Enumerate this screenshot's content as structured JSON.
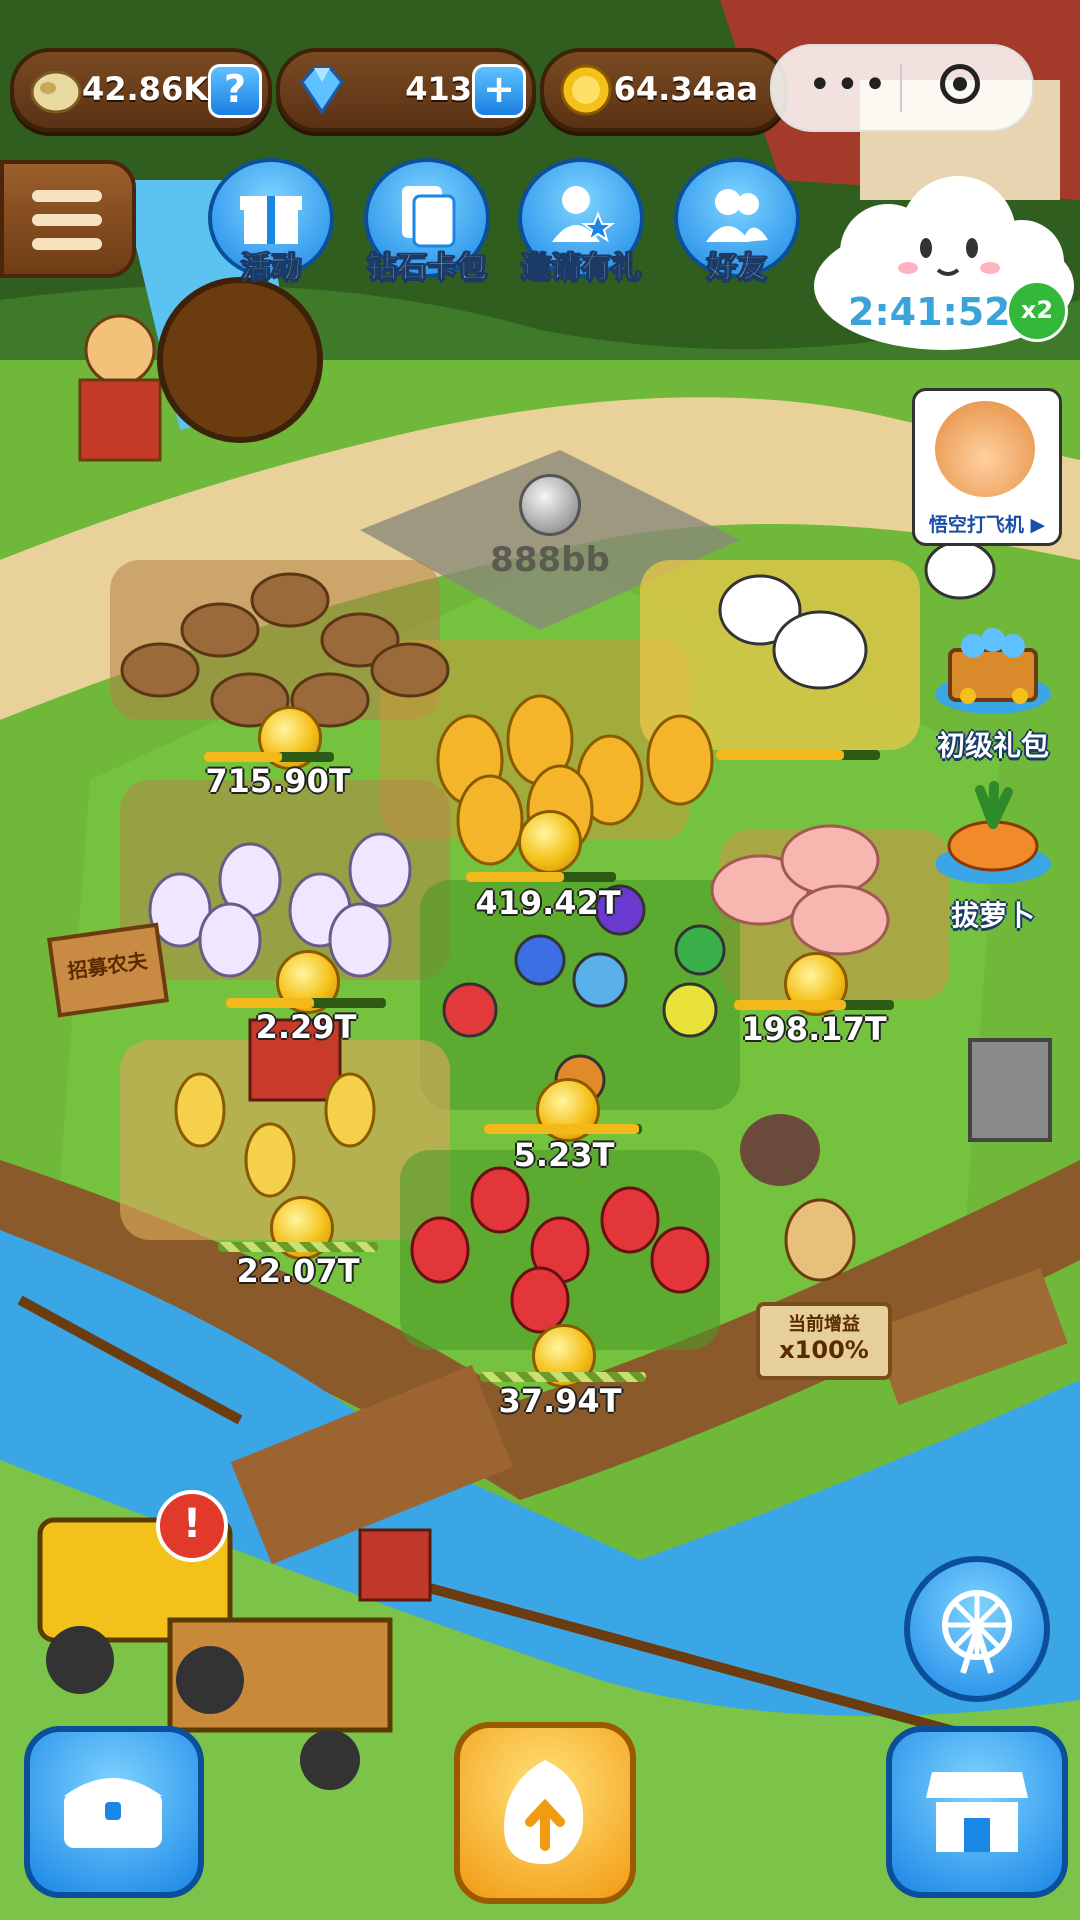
{
  "currencies": {
    "seeds": {
      "value": "42.86K",
      "icon": "seed-icon",
      "action": "help-icon"
    },
    "diamonds": {
      "value": "413",
      "icon": "diamond-icon",
      "action": "plus-icon"
    },
    "coins": {
      "value": "64.34aa",
      "icon": "coin-icon"
    }
  },
  "top_menu": [
    {
      "label": "活动",
      "icon": "gift-icon"
    },
    {
      "label": "钻石卡包",
      "icon": "card-pack-icon"
    },
    {
      "label": "邀请有礼",
      "icon": "invite-icon"
    },
    {
      "label": "好友",
      "icon": "friends-icon"
    }
  ],
  "cloud_timer": {
    "time": "2:41:52",
    "multiplier": "x2"
  },
  "ad": {
    "label": "悟空打飞机 ▶"
  },
  "side_panels": [
    {
      "label": "初级礼包",
      "icon": "treasure-chest-icon"
    },
    {
      "label": "拔萝卜",
      "icon": "carrot-icon"
    }
  ],
  "locked_plot": {
    "price": "888bb"
  },
  "plots": [
    {
      "name": "potato",
      "earning": "715.90T",
      "progress": 0.6
    },
    {
      "name": "pineapple",
      "earning": "419.42T",
      "progress": 0.65
    },
    {
      "name": "dog",
      "earning": "",
      "progress": 0.78
    },
    {
      "name": "radish",
      "earning": "2.29T",
      "progress": 0.55
    },
    {
      "name": "pig",
      "earning": "198.17T",
      "progress": 0.7
    },
    {
      "name": "gourd",
      "earning": "5.23T",
      "progress": 0.98
    },
    {
      "name": "chicken",
      "earning": "22.07T",
      "progress": 0.0
    },
    {
      "name": "strawberry",
      "earning": "37.94T",
      "progress": 0.0
    }
  ],
  "sign": {
    "text": "招募农夫"
  },
  "boost": {
    "line1": "当前增益",
    "line2": "x100%"
  },
  "colors": {
    "accent_blue": "#1a86e6",
    "coin_gold": "#f5c019",
    "grass": "#6fb83a",
    "water": "#3aa6e6"
  }
}
